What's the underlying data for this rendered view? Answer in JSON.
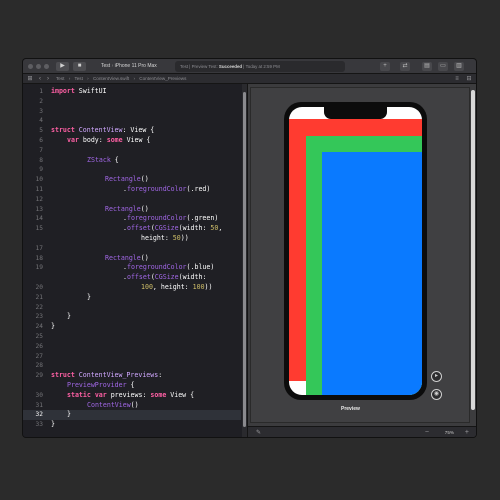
{
  "toolbar": {
    "scheme_target": "Test",
    "scheme_separator": "›",
    "device": "iPhone 11 Pro Max",
    "status_prefix": "Test | Preview Test: ",
    "status_result": "Succeeded",
    "status_time": " | Today at 2:59 PM"
  },
  "jumpbar": {
    "crumbs": [
      "Test",
      "Test",
      "ContentView.swift",
      "ContentView_Previews"
    ],
    "separator": "›"
  },
  "editor": {
    "current_line": 32,
    "lines": [
      {
        "n": "1"
      },
      {
        "n": "2"
      },
      {
        "n": "3"
      },
      {
        "n": "4"
      },
      {
        "n": "5"
      },
      {
        "n": "6"
      },
      {
        "n": "7"
      },
      {
        "n": "8"
      },
      {
        "n": "9"
      },
      {
        "n": "10"
      },
      {
        "n": "11"
      },
      {
        "n": "12"
      },
      {
        "n": "13"
      },
      {
        "n": "14"
      },
      {
        "n": "15"
      },
      {
        "n": ""
      },
      {
        "n": "17"
      },
      {
        "n": "18"
      },
      {
        "n": "19"
      },
      {
        "n": ""
      },
      {
        "n": "20"
      },
      {
        "n": "21"
      },
      {
        "n": "22"
      },
      {
        "n": "23"
      },
      {
        "n": "24"
      },
      {
        "n": "25"
      },
      {
        "n": "26"
      },
      {
        "n": "27"
      },
      {
        "n": "28"
      },
      {
        "n": "29"
      },
      {
        "n": ""
      },
      {
        "n": "30"
      },
      {
        "n": "31"
      },
      {
        "n": "32"
      },
      {
        "n": "33"
      }
    ],
    "code": {
      "import_kw": "import",
      "import_mod": " SwiftUI",
      "struct_kw": "struct",
      "cv_name": " ContentView",
      "colon_view": ": View {",
      "var_kw": "var",
      "body": " body: ",
      "some_kw": "some",
      "view_brace": " View {",
      "zstack": "ZStack",
      "open_brace": " {",
      "rectangle": "Rectangle",
      "parens": "()",
      "fg_color": "foregroundColor",
      "red": "(.red)",
      "green": "(.green)",
      "blue": "(.blue)",
      "offset": "offset",
      "cgsize": "CGSize",
      "width50": "(width: ",
      "n50a": "50",
      "comma": ",",
      "height_label": "height: ",
      "n50b": "50",
      "close_paren2": "))",
      "width_only": "(width:",
      "n100a": "100",
      "comma_height": ", height: ",
      "n100b": "100",
      "close_brace": "}",
      "cvp_name": " ContentView_Previews",
      "colon": ":",
      "preview_provider": "PreviewProvider",
      "static_kw": "static",
      "previews": " previews: ",
      "content_view_call": "ContentView",
      "dot": "."
    }
  },
  "canvas": {
    "preview_label": "Preview",
    "zoom_level": "75%",
    "zoom_out": "−",
    "zoom_in": "+",
    "pin_icon": "pin-icon",
    "live_icon": "live-preview-icon",
    "inspect_icon": "inspect-preview-icon"
  },
  "colors": {
    "red": "#ff3b30",
    "green": "#34c759",
    "blue": "#0a7aff",
    "keyword": "#fc5fa3"
  }
}
